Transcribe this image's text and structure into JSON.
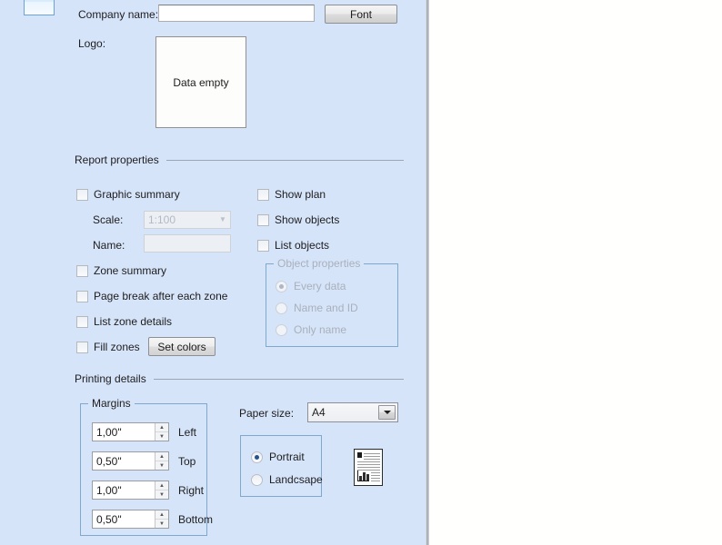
{
  "panel": {
    "app_icon_name": "report-window-icon",
    "company": {
      "label": "Company name:",
      "value": "",
      "placeholder": "",
      "font_button_label": "Font"
    },
    "logo": {
      "label": "Logo:",
      "empty_text": "Data empty"
    },
    "report_properties": {
      "section_title": "Report properties",
      "graphic_summary": {
        "label": "Graphic summary",
        "checked": false
      },
      "scale": {
        "label": "Scale:",
        "value": "1:100",
        "disabled": true
      },
      "name": {
        "label": "Name:",
        "value": "",
        "disabled": true
      },
      "show_plan": {
        "label": "Show plan",
        "checked": false
      },
      "show_objects": {
        "label": "Show objects",
        "checked": false
      },
      "list_objects": {
        "label": "List objects",
        "checked": false
      },
      "zone_summary": {
        "label": "Zone summary",
        "checked": false
      },
      "page_break_after_each_zone": {
        "label": "Page break after each zone",
        "checked": false
      },
      "list_zone_details": {
        "label": "List zone details",
        "checked": false
      },
      "fill_zones": {
        "label": "Fill zones",
        "checked": false
      },
      "set_colors_button_label": "Set colors",
      "object_properties": {
        "title": "Object properties",
        "disabled": true,
        "options": [
          {
            "label": "Every data",
            "selected": true
          },
          {
            "label": "Name and ID",
            "selected": false
          },
          {
            "label": "Only name",
            "selected": false
          }
        ]
      }
    },
    "printing_details": {
      "section_title": "Printing details",
      "margins": {
        "title": "Margins",
        "rows": [
          {
            "value": "1,00\"",
            "caption": "Left"
          },
          {
            "value": "0,50\"",
            "caption": "Top"
          },
          {
            "value": "1,00\"",
            "caption": "Right"
          },
          {
            "value": "0,50\"",
            "caption": "Bottom"
          }
        ]
      },
      "paper_size": {
        "label": "Paper size:",
        "value": "A4"
      },
      "orientation": {
        "options": [
          {
            "label": "Portrait",
            "selected": true
          },
          {
            "label": "Landcsape",
            "selected": false
          }
        ]
      },
      "preview_icon_name": "page-preview-icon"
    }
  },
  "colors": {
    "panel_background": "#d6e4fa",
    "group_border": "#7fa8cf",
    "radio_dot": "#23528c",
    "disabled_text": "#a8b0bb"
  }
}
